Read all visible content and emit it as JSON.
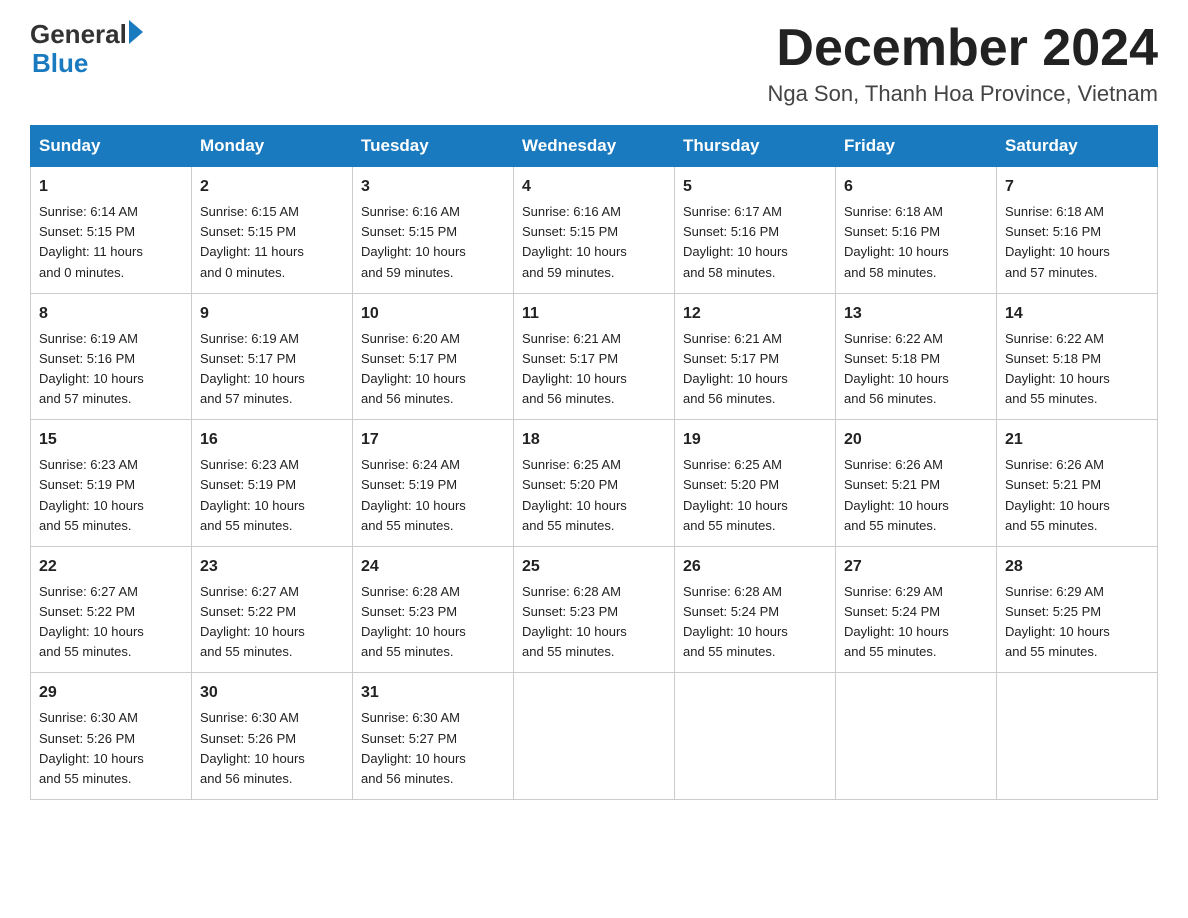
{
  "logo": {
    "text_general": "General",
    "text_blue": "Blue"
  },
  "title": {
    "month_year": "December 2024",
    "location": "Nga Son, Thanh Hoa Province, Vietnam"
  },
  "weekdays": [
    "Sunday",
    "Monday",
    "Tuesday",
    "Wednesday",
    "Thursday",
    "Friday",
    "Saturday"
  ],
  "weeks": [
    [
      {
        "day": "1",
        "sunrise": "6:14 AM",
        "sunset": "5:15 PM",
        "daylight": "11 hours and 0 minutes."
      },
      {
        "day": "2",
        "sunrise": "6:15 AM",
        "sunset": "5:15 PM",
        "daylight": "11 hours and 0 minutes."
      },
      {
        "day": "3",
        "sunrise": "6:16 AM",
        "sunset": "5:15 PM",
        "daylight": "10 hours and 59 minutes."
      },
      {
        "day": "4",
        "sunrise": "6:16 AM",
        "sunset": "5:15 PM",
        "daylight": "10 hours and 59 minutes."
      },
      {
        "day": "5",
        "sunrise": "6:17 AM",
        "sunset": "5:16 PM",
        "daylight": "10 hours and 58 minutes."
      },
      {
        "day": "6",
        "sunrise": "6:18 AM",
        "sunset": "5:16 PM",
        "daylight": "10 hours and 58 minutes."
      },
      {
        "day": "7",
        "sunrise": "6:18 AM",
        "sunset": "5:16 PM",
        "daylight": "10 hours and 57 minutes."
      }
    ],
    [
      {
        "day": "8",
        "sunrise": "6:19 AM",
        "sunset": "5:16 PM",
        "daylight": "10 hours and 57 minutes."
      },
      {
        "day": "9",
        "sunrise": "6:19 AM",
        "sunset": "5:17 PM",
        "daylight": "10 hours and 57 minutes."
      },
      {
        "day": "10",
        "sunrise": "6:20 AM",
        "sunset": "5:17 PM",
        "daylight": "10 hours and 56 minutes."
      },
      {
        "day": "11",
        "sunrise": "6:21 AM",
        "sunset": "5:17 PM",
        "daylight": "10 hours and 56 minutes."
      },
      {
        "day": "12",
        "sunrise": "6:21 AM",
        "sunset": "5:17 PM",
        "daylight": "10 hours and 56 minutes."
      },
      {
        "day": "13",
        "sunrise": "6:22 AM",
        "sunset": "5:18 PM",
        "daylight": "10 hours and 56 minutes."
      },
      {
        "day": "14",
        "sunrise": "6:22 AM",
        "sunset": "5:18 PM",
        "daylight": "10 hours and 55 minutes."
      }
    ],
    [
      {
        "day": "15",
        "sunrise": "6:23 AM",
        "sunset": "5:19 PM",
        "daylight": "10 hours and 55 minutes."
      },
      {
        "day": "16",
        "sunrise": "6:23 AM",
        "sunset": "5:19 PM",
        "daylight": "10 hours and 55 minutes."
      },
      {
        "day": "17",
        "sunrise": "6:24 AM",
        "sunset": "5:19 PM",
        "daylight": "10 hours and 55 minutes."
      },
      {
        "day": "18",
        "sunrise": "6:25 AM",
        "sunset": "5:20 PM",
        "daylight": "10 hours and 55 minutes."
      },
      {
        "day": "19",
        "sunrise": "6:25 AM",
        "sunset": "5:20 PM",
        "daylight": "10 hours and 55 minutes."
      },
      {
        "day": "20",
        "sunrise": "6:26 AM",
        "sunset": "5:21 PM",
        "daylight": "10 hours and 55 minutes."
      },
      {
        "day": "21",
        "sunrise": "6:26 AM",
        "sunset": "5:21 PM",
        "daylight": "10 hours and 55 minutes."
      }
    ],
    [
      {
        "day": "22",
        "sunrise": "6:27 AM",
        "sunset": "5:22 PM",
        "daylight": "10 hours and 55 minutes."
      },
      {
        "day": "23",
        "sunrise": "6:27 AM",
        "sunset": "5:22 PM",
        "daylight": "10 hours and 55 minutes."
      },
      {
        "day": "24",
        "sunrise": "6:28 AM",
        "sunset": "5:23 PM",
        "daylight": "10 hours and 55 minutes."
      },
      {
        "day": "25",
        "sunrise": "6:28 AM",
        "sunset": "5:23 PM",
        "daylight": "10 hours and 55 minutes."
      },
      {
        "day": "26",
        "sunrise": "6:28 AM",
        "sunset": "5:24 PM",
        "daylight": "10 hours and 55 minutes."
      },
      {
        "day": "27",
        "sunrise": "6:29 AM",
        "sunset": "5:24 PM",
        "daylight": "10 hours and 55 minutes."
      },
      {
        "day": "28",
        "sunrise": "6:29 AM",
        "sunset": "5:25 PM",
        "daylight": "10 hours and 55 minutes."
      }
    ],
    [
      {
        "day": "29",
        "sunrise": "6:30 AM",
        "sunset": "5:26 PM",
        "daylight": "10 hours and 55 minutes."
      },
      {
        "day": "30",
        "sunrise": "6:30 AM",
        "sunset": "5:26 PM",
        "daylight": "10 hours and 56 minutes."
      },
      {
        "day": "31",
        "sunrise": "6:30 AM",
        "sunset": "5:27 PM",
        "daylight": "10 hours and 56 minutes."
      },
      null,
      null,
      null,
      null
    ]
  ],
  "labels": {
    "sunrise": "Sunrise:",
    "sunset": "Sunset:",
    "daylight": "Daylight:"
  }
}
